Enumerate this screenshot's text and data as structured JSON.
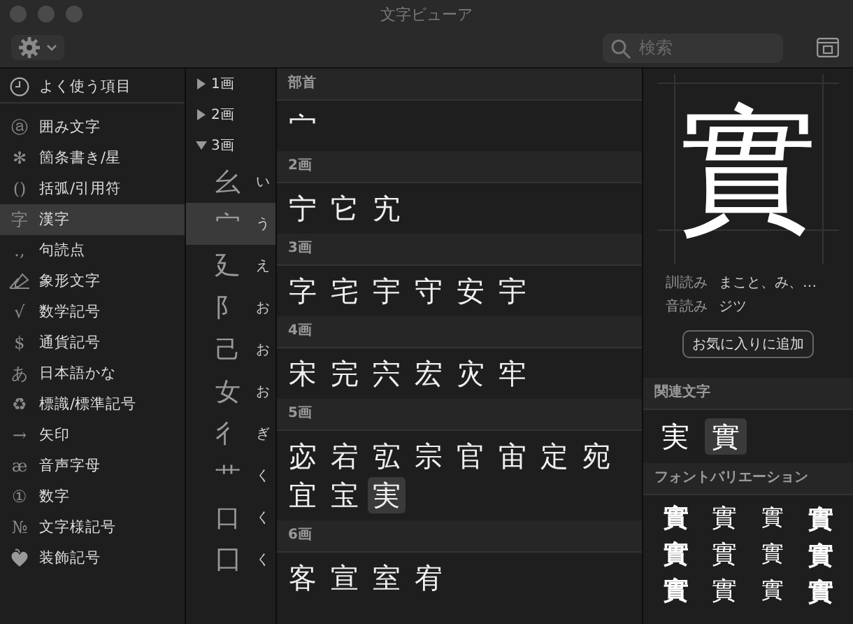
{
  "window": {
    "title": "文字ビューア"
  },
  "toolbar": {
    "search": {
      "placeholder": "検索"
    }
  },
  "sidebar": {
    "favorites": {
      "label": "よく使う項目",
      "selected": false
    },
    "items": [
      {
        "kind": "glyph",
        "glyph": "ⓐ",
        "label": "囲み文字",
        "selected": false
      },
      {
        "kind": "glyph",
        "glyph": "✻",
        "label": "箇条書き/星",
        "selected": false
      },
      {
        "kind": "glyph",
        "glyph": "()",
        "label": "括弧/引用符",
        "selected": false
      },
      {
        "kind": "glyph",
        "glyph": "字",
        "label": "漢字",
        "selected": true
      },
      {
        "kind": "glyph",
        "glyph": ".,",
        "label": "句読点",
        "selected": false
      },
      {
        "kind": "pictograph",
        "label": "象形文字",
        "selected": false
      },
      {
        "kind": "glyph",
        "glyph": "√",
        "label": "数学記号",
        "selected": false
      },
      {
        "kind": "glyph",
        "glyph": "$",
        "label": "通貨記号",
        "selected": false
      },
      {
        "kind": "glyph",
        "glyph": "あ",
        "label": "日本語かな",
        "selected": false
      },
      {
        "kind": "glyph",
        "glyph": "♻",
        "label": "標識/標準記号",
        "selected": false
      },
      {
        "kind": "glyph",
        "glyph": "→",
        "label": "矢印",
        "selected": false
      },
      {
        "kind": "glyph",
        "glyph": "æ",
        "label": "音声字母",
        "selected": false
      },
      {
        "kind": "glyph",
        "glyph": "①",
        "label": "数字",
        "selected": false
      },
      {
        "kind": "glyph",
        "glyph": "№",
        "label": "文字様記号",
        "selected": false
      },
      {
        "kind": "ornament",
        "label": "装飾記号",
        "selected": false
      }
    ]
  },
  "radicals": [
    {
      "label": "1画",
      "expanded": false
    },
    {
      "label": "2画",
      "expanded": false
    },
    {
      "label": "3画",
      "expanded": true,
      "children": [
        {
          "glyph": "幺",
          "reading": "い",
          "selected": false
        },
        {
          "glyph": "宀",
          "reading": "う",
          "selected": true
        },
        {
          "glyph": "廴",
          "reading": "え",
          "selected": false
        },
        {
          "glyph": "阝",
          "reading": "お",
          "selected": false
        },
        {
          "glyph": "己",
          "reading": "お",
          "selected": false
        },
        {
          "glyph": "女",
          "reading": "お",
          "selected": false
        },
        {
          "glyph": "彳",
          "reading": "ぎ",
          "selected": false
        },
        {
          "glyph": "艹",
          "reading": "く",
          "selected": false
        },
        {
          "glyph": "口",
          "reading": "く",
          "selected": false
        },
        {
          "glyph": "囗",
          "reading": "く",
          "selected": false
        }
      ]
    }
  ],
  "characters": [
    {
      "header": "部首",
      "chars": [
        {
          "char": "宀",
          "selected": false
        }
      ]
    },
    {
      "header": "2画",
      "chars": [
        {
          "char": "宁",
          "selected": false
        },
        {
          "char": "它",
          "selected": false
        },
        {
          "char": "宄",
          "selected": false
        }
      ]
    },
    {
      "header": "3画",
      "chars": [
        {
          "char": "字",
          "selected": false
        },
        {
          "char": "宅",
          "selected": false
        },
        {
          "char": "宇",
          "selected": false
        },
        {
          "char": "守",
          "selected": false
        },
        {
          "char": "安",
          "selected": false
        },
        {
          "char": "宇",
          "selected": false
        }
      ]
    },
    {
      "header": "4画",
      "chars": [
        {
          "char": "宋",
          "selected": false
        },
        {
          "char": "完",
          "selected": false
        },
        {
          "char": "宍",
          "selected": false
        },
        {
          "char": "宏",
          "selected": false
        },
        {
          "char": "灾",
          "selected": false
        },
        {
          "char": "牢",
          "selected": false
        }
      ]
    },
    {
      "header": "5画",
      "chars": [
        {
          "char": "宓",
          "selected": false
        },
        {
          "char": "宕",
          "selected": false
        },
        {
          "char": "宖",
          "selected": false
        },
        {
          "char": "宗",
          "selected": false
        },
        {
          "char": "官",
          "selected": false
        },
        {
          "char": "宙",
          "selected": false
        },
        {
          "char": "定",
          "selected": false
        },
        {
          "char": "宛",
          "selected": false
        },
        {
          "char": "宜",
          "selected": false
        },
        {
          "char": "宝",
          "selected": false
        },
        {
          "char": "実",
          "selected": true
        }
      ]
    },
    {
      "header": "6画",
      "chars": [
        {
          "char": "客",
          "selected": false
        },
        {
          "char": "宣",
          "selected": false
        },
        {
          "char": "室",
          "selected": false
        },
        {
          "char": "宥",
          "selected": false
        }
      ]
    }
  ],
  "detail": {
    "glyph": "實",
    "readings": [
      {
        "label": "訓読み",
        "value": "まこと、み、…"
      },
      {
        "label": "音読み",
        "value": "ジツ"
      }
    ],
    "favorite_button": "お気に入りに追加",
    "related": {
      "header": "関連文字",
      "chars": [
        {
          "char": "実",
          "selected": false
        },
        {
          "char": "實",
          "selected": true
        }
      ]
    },
    "variations": {
      "header": "フォントバリエーション",
      "chars": [
        "實",
        "實",
        "實",
        "實",
        "實",
        "實",
        "實",
        "實",
        "實",
        "實",
        "實",
        "實"
      ]
    }
  }
}
